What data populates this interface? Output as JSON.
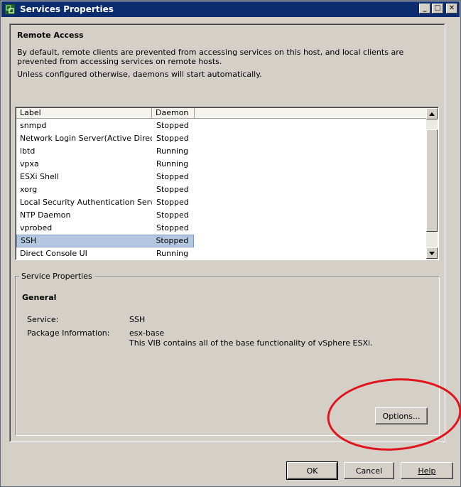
{
  "window": {
    "title": "Services Properties",
    "controls": {
      "minimize": "_",
      "maximize": "□",
      "close": "✕"
    }
  },
  "remote_access": {
    "title": "Remote Access",
    "description": "By default, remote clients are prevented from accessing services on this host, and local clients are prevented from accessing services on remote hosts.",
    "note": "Unless configured otherwise, daemons will start automatically."
  },
  "services_table": {
    "columns": [
      "Label",
      "Daemon"
    ],
    "rows": [
      {
        "label": "snmpd",
        "daemon": "Stopped"
      },
      {
        "label": "Network Login Server(Active Direc...",
        "daemon": "Stopped"
      },
      {
        "label": "lbtd",
        "daemon": "Running"
      },
      {
        "label": "vpxa",
        "daemon": "Running"
      },
      {
        "label": "ESXi Shell",
        "daemon": "Stopped"
      },
      {
        "label": "xorg",
        "daemon": "Stopped"
      },
      {
        "label": "Local Security Authentication Serv...",
        "daemon": "Stopped"
      },
      {
        "label": "NTP Daemon",
        "daemon": "Stopped"
      },
      {
        "label": "vprobed",
        "daemon": "Stopped"
      },
      {
        "label": "SSH",
        "daemon": "Stopped"
      },
      {
        "label": "Direct Console UI",
        "daemon": "Running"
      }
    ],
    "selected_index": 9
  },
  "service_properties": {
    "legend": "Service Properties",
    "general_title": "General",
    "service_label": "Service:",
    "service_value": "SSH",
    "package_label": "Package Information:",
    "package_name": "esx-base",
    "package_desc": "This VIB contains all of the base functionality of vSphere ESXi.",
    "options_button": "Options..."
  },
  "footer": {
    "ok": "OK",
    "cancel": "Cancel",
    "help": "Help"
  },
  "colors": {
    "titlebar": "#0b2c6e",
    "dialog_bg": "#d4d0c8",
    "selection": "#b3c7e0",
    "annotation": "#e0141e"
  }
}
